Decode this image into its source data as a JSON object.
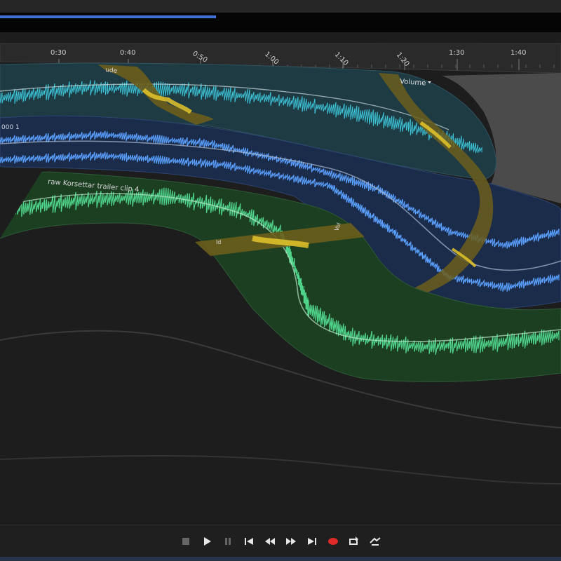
{
  "ruler": {
    "ticks": [
      "0:30",
      "0:40",
      "0:50",
      "1:00",
      "1:10",
      "1:20",
      "1:30",
      "1:40"
    ]
  },
  "tracks": {
    "audio_top": {
      "volume_label": "Volume",
      "clip_tag": "ude"
    },
    "audio_mid": {
      "label": "000 1"
    },
    "video": {
      "clip_name": "raw Korsettar trailer clip 4",
      "tag_left": "ld",
      "tag_right": "Vol"
    }
  },
  "transport": {
    "buttons": [
      "stop",
      "play",
      "pause",
      "go-to-start",
      "rewind",
      "fast-forward",
      "go-to-end",
      "record",
      "loop",
      "shuttle"
    ]
  },
  "colors": {
    "bg": "#1d1d1d",
    "ruler_bg": "#2a2a2a",
    "teal_track": "#1e3b44",
    "teal_wave": "#3cc3d6",
    "blue_track": "#1b2b4a",
    "blue_wave": "#5aa0ff",
    "green_track": "#1c3f22",
    "green_wave": "#4fd38a",
    "yellow_fade": "#e4c62a",
    "playhead": "#3d6fd6",
    "record": "#e02a2a"
  }
}
